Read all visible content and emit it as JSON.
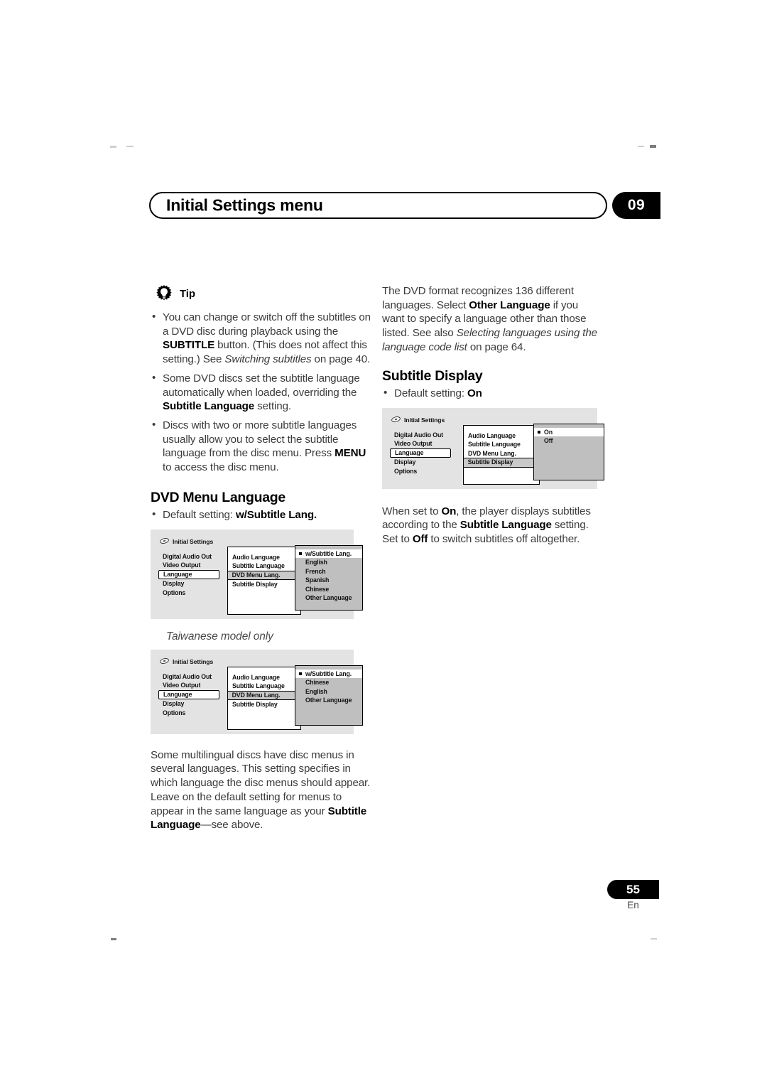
{
  "header": {
    "title": "Initial Settings menu",
    "chapter": "09"
  },
  "footer": {
    "page_number": "55",
    "language_code": "En"
  },
  "left_column": {
    "tip": {
      "icon": "lightbulb-tip-icon",
      "label": "Tip",
      "bullets": [
        {
          "parts": [
            {
              "t": "You can change or switch off the subtitles on a DVD disc during playback using the ",
              "s": "normal"
            },
            {
              "t": "SUBTITLE",
              "s": "bold"
            },
            {
              "t": " button. (This does not affect this setting.) See ",
              "s": "normal"
            },
            {
              "t": "Switching subtitles",
              "s": "italic"
            },
            {
              "t": " on page 40.",
              "s": "normal"
            }
          ]
        },
        {
          "parts": [
            {
              "t": "Some DVD discs set the subtitle language automatically when loaded, overriding the ",
              "s": "normal"
            },
            {
              "t": "Subtitle Language",
              "s": "bold"
            },
            {
              "t": " setting.",
              "s": "normal"
            }
          ]
        },
        {
          "parts": [
            {
              "t": "Discs with two or more subtitle languages usually allow you to select the subtitle language from the disc menu. Press ",
              "s": "normal"
            },
            {
              "t": "MENU",
              "s": "bold"
            },
            {
              "t": " to access the disc menu.",
              "s": "normal"
            }
          ]
        }
      ]
    },
    "dvd_menu_language": {
      "heading": "DVD Menu Language",
      "default_setting": {
        "prefix": "Default setting: ",
        "value": "w/Subtitle Lang."
      }
    },
    "taiwanese_caption": "Taiwanese model only",
    "closing_paragraph": {
      "parts": [
        {
          "t": "Some multilingual discs have disc menus in several languages. This setting specifies in which language the disc menus should appear. Leave on the default setting for menus to appear in the same language as your ",
          "s": "normal"
        },
        {
          "t": "Subtitle Language",
          "s": "bold"
        },
        {
          "t": "—see above.",
          "s": "normal"
        }
      ]
    }
  },
  "right_column": {
    "intro_paragraph": {
      "parts": [
        {
          "t": "The DVD format recognizes 136 different languages. Select ",
          "s": "normal"
        },
        {
          "t": "Other Language",
          "s": "bold"
        },
        {
          "t": " if you want to specify a language other than those listed. See also ",
          "s": "normal"
        },
        {
          "t": "Selecting languages using the language code list",
          "s": "italic"
        },
        {
          "t": " on page 64.",
          "s": "normal"
        }
      ]
    },
    "subtitle_display": {
      "heading": "Subtitle Display",
      "default_setting": {
        "prefix": "Default setting: ",
        "value": "On"
      }
    },
    "closing_paragraph": {
      "parts": [
        {
          "t": "When set to ",
          "s": "normal"
        },
        {
          "t": "On",
          "s": "bold"
        },
        {
          "t": ", the player displays subtitles according to the ",
          "s": "normal"
        },
        {
          "t": "Subtitle Language",
          "s": "bold"
        },
        {
          "t": " setting. Set to ",
          "s": "normal"
        },
        {
          "t": "Off",
          "s": "bold"
        },
        {
          "t": " to switch subtitles off altogether.",
          "s": "normal"
        }
      ]
    }
  },
  "osd_screens": [
    {
      "id": "dvd-menu-language-osd",
      "title": "Initial Settings",
      "icon": "disc-icon",
      "level1": [
        {
          "label": "Digital Audio Out",
          "selected": false
        },
        {
          "label": "Video Output",
          "selected": false
        },
        {
          "label": "Language",
          "selected": true
        },
        {
          "label": "Display",
          "selected": false
        },
        {
          "label": "Options",
          "selected": false
        }
      ],
      "level2": [
        {
          "label": "Audio Language",
          "selected": false
        },
        {
          "label": "Subtitle Language",
          "selected": false
        },
        {
          "label": "DVD Menu Lang.",
          "selected": true
        },
        {
          "label": "Subtitle Display",
          "selected": false
        }
      ],
      "level3": [
        {
          "label": "w/Subtitle Lang.",
          "selected": true
        },
        {
          "label": "English",
          "selected": false
        },
        {
          "label": "French",
          "selected": false
        },
        {
          "label": "Spanish",
          "selected": false
        },
        {
          "label": "Chinese",
          "selected": false
        },
        {
          "label": "Other Language",
          "selected": false
        }
      ]
    },
    {
      "id": "dvd-menu-language-taiwan-osd",
      "title": "Initial Settings",
      "icon": "disc-icon",
      "level1": [
        {
          "label": "Digital Audio Out",
          "selected": false
        },
        {
          "label": "Video Output",
          "selected": false
        },
        {
          "label": "Language",
          "selected": true
        },
        {
          "label": "Display",
          "selected": false
        },
        {
          "label": "Options",
          "selected": false
        }
      ],
      "level2": [
        {
          "label": "Audio Language",
          "selected": false
        },
        {
          "label": "Subtitle Language",
          "selected": false
        },
        {
          "label": "DVD Menu Lang.",
          "selected": true
        },
        {
          "label": "Subtitle Display",
          "selected": false
        }
      ],
      "level3": [
        {
          "label": "w/Subtitle Lang.",
          "selected": true
        },
        {
          "label": "Chinese",
          "selected": false
        },
        {
          "label": "English",
          "selected": false
        },
        {
          "label": "Other Language",
          "selected": false
        }
      ]
    },
    {
      "id": "subtitle-display-osd",
      "title": "Initial Settings",
      "icon": "disc-icon",
      "level1": [
        {
          "label": "Digital Audio Out",
          "selected": false
        },
        {
          "label": "Video Output",
          "selected": false
        },
        {
          "label": "Language",
          "selected": true
        },
        {
          "label": "Display",
          "selected": false
        },
        {
          "label": "Options",
          "selected": false
        }
      ],
      "level2": [
        {
          "label": "Audio Language",
          "selected": false
        },
        {
          "label": "Subtitle Language",
          "selected": false
        },
        {
          "label": "DVD Menu Lang.",
          "selected": false
        },
        {
          "label": "Subtitle Display",
          "selected": true
        }
      ],
      "level3": [
        {
          "label": "On",
          "selected": true
        },
        {
          "label": "Off",
          "selected": false
        }
      ]
    }
  ],
  "colors": {
    "panel_background": "#e3e3e3",
    "option_panel": "#bfbfbf",
    "selected_row_mid": "#c9c9c9",
    "body_text": "#3b3b3b",
    "accent_black": "#000000"
  }
}
